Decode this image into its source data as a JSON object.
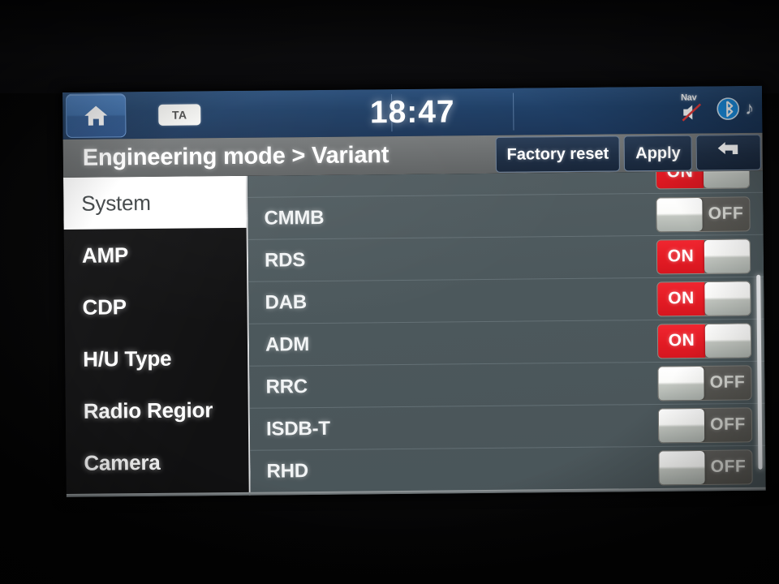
{
  "statusbar": {
    "home_icon": "home-icon",
    "ta_badge": "TA",
    "clock": "18:47",
    "nav_mute_label": "Nav",
    "nav_mute_icon": "speaker-mute-icon",
    "bluetooth_icon": "bluetooth-icon",
    "music_note_icon": "music-note-icon"
  },
  "titlebar": {
    "title": "Engineering mode > Variant",
    "factory_reset_label": "Factory reset",
    "apply_label": "Apply",
    "back_icon": "back-arrow-icon"
  },
  "sidebar": {
    "items": [
      {
        "label": "System",
        "selected": true
      },
      {
        "label": "AMP",
        "selected": false
      },
      {
        "label": "CDP",
        "selected": false
      },
      {
        "label": "H/U Type",
        "selected": false
      },
      {
        "label": "Radio Regior",
        "selected": false
      },
      {
        "label": "Camera",
        "selected": false
      }
    ]
  },
  "variant_list": {
    "on_label": "ON",
    "off_label": "OFF",
    "rows": [
      {
        "label": "",
        "state": "ON",
        "partial": true
      },
      {
        "label": "CMMB",
        "state": "OFF",
        "partial": false
      },
      {
        "label": "RDS",
        "state": "ON",
        "partial": false
      },
      {
        "label": "DAB",
        "state": "ON",
        "partial": false
      },
      {
        "label": "ADM",
        "state": "ON",
        "partial": false
      },
      {
        "label": "RRC",
        "state": "OFF",
        "partial": false
      },
      {
        "label": "ISDB-T",
        "state": "OFF",
        "partial": false
      },
      {
        "label": "RHD",
        "state": "OFF",
        "partial": false
      }
    ]
  },
  "colors": {
    "accent_red": "#e31b24",
    "statusbar_blue": "#1f3f66",
    "titlebar_gray": "#6a6d6e",
    "list_bg": "#4c585c",
    "sidebar_bg": "#111112"
  }
}
